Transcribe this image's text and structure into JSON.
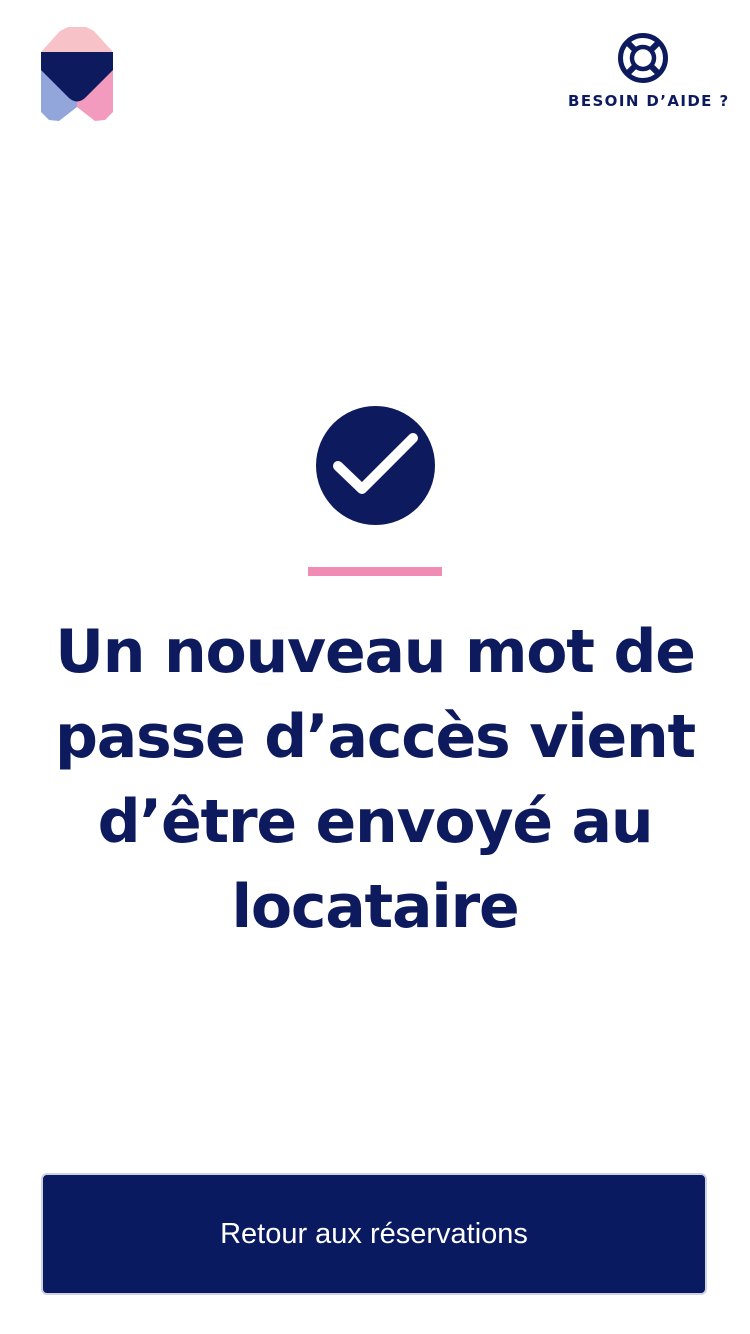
{
  "header": {
    "logo_icon": "brand-logo-icon",
    "help_icon": "lifebuoy-icon",
    "help_label": "BESOIN D’AIDE ?"
  },
  "confirmation": {
    "icon": "check-circle-icon",
    "message": "Un nouveau mot de passe d’accès vient d’être envoyé au locataire"
  },
  "actions": {
    "back_label": "Retour aux réservations"
  },
  "colors": {
    "navy": "#0d1b5e",
    "button_bg": "#0a1a60",
    "accent_pink": "#f08cb3",
    "logo_light_pink": "#f8c3c8",
    "logo_blue": "#93a6dc",
    "logo_pink": "#f39bbe"
  }
}
